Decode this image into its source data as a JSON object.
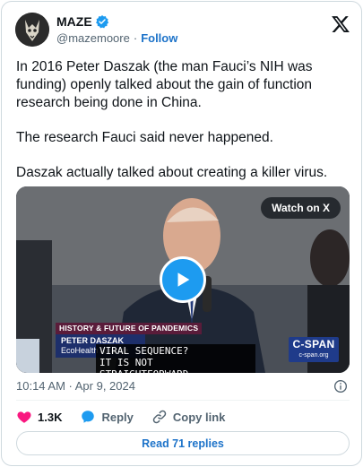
{
  "author": {
    "name": "MAZE",
    "handle": "@mazemoore",
    "separator": "·",
    "follow_label": "Follow"
  },
  "tweet": {
    "paragraphs": [
      "In 2016 Peter Daszak (the man Fauci’s NIH was funding) openly talked about the gain of function research being done in China.",
      "The research Fauci said never happened.",
      "Daszak actually talked about creating a killer virus."
    ]
  },
  "video": {
    "watch_label": "Watch on X",
    "banner_title": "HISTORY & FUTURE OF PANDEMICS",
    "speaker_name": "PETER DASZAK",
    "speaker_org": "EcoHealth Alliance",
    "caption_line1": "VIRAL SEQUENCE?",
    "caption_line2": "IT IS NOT STRAIGHTFORWARD.",
    "network_name": "C-SPAN",
    "network_url": "c-span.org"
  },
  "meta": {
    "timestamp": "10:14 AM · Apr 9, 2024"
  },
  "actions": {
    "like_count": "1.3K",
    "reply_label": "Reply",
    "copy_label": "Copy link"
  },
  "footer": {
    "read_replies_label": "Read 71 replies"
  },
  "colors": {
    "accent": "#1d9bf0",
    "link": "#1d73c9",
    "like": "#f91880",
    "text": "#0f1419",
    "muted": "#536471"
  },
  "icons": [
    "verified-badge-icon",
    "x-logo-icon",
    "play-icon",
    "info-icon",
    "heart-icon",
    "reply-bubble-icon",
    "link-icon"
  ]
}
